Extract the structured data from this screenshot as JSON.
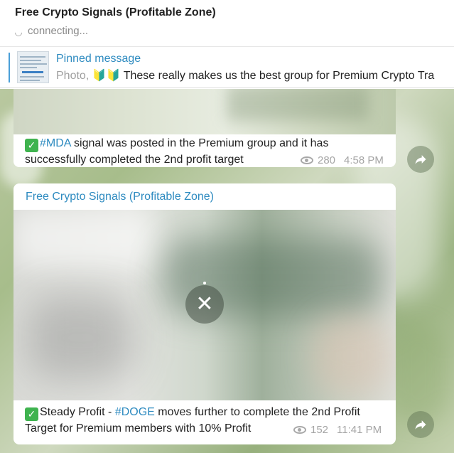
{
  "header": {
    "title": "Free Crypto Signals (Profitable Zone)",
    "status": "connecting..."
  },
  "pinned": {
    "label": "Pinned message",
    "type_label": "Photo,",
    "emoji": "🔰🔰",
    "text": "These really makes us the best group for Premium Crypto Tra"
  },
  "messages": [
    {
      "text_prefix": "✅",
      "hashtag": "#MDA",
      "text": " signal was posted in the Premium group and it has successfully completed the 2nd profit target",
      "views": "280",
      "time": "4:58 PM"
    },
    {
      "author": "Free Crypto Signals (Profitable Zone)",
      "text_prefix": "✅",
      "text_before": "Steady Profit - ",
      "hashtag": "#DOGE",
      "text": " moves further to complete the 2nd Profit Target for Premium members with 10% Profit",
      "views": "152",
      "time": "11:41 PM"
    }
  ],
  "icons": {
    "status": "loading-spinner-icon",
    "views": "eye-icon",
    "share": "share-arrow-icon",
    "cancel": "close-icon",
    "check": "check-mark-icon"
  },
  "colors": {
    "accent": "#2e8bc0",
    "check": "#3fb34f"
  }
}
